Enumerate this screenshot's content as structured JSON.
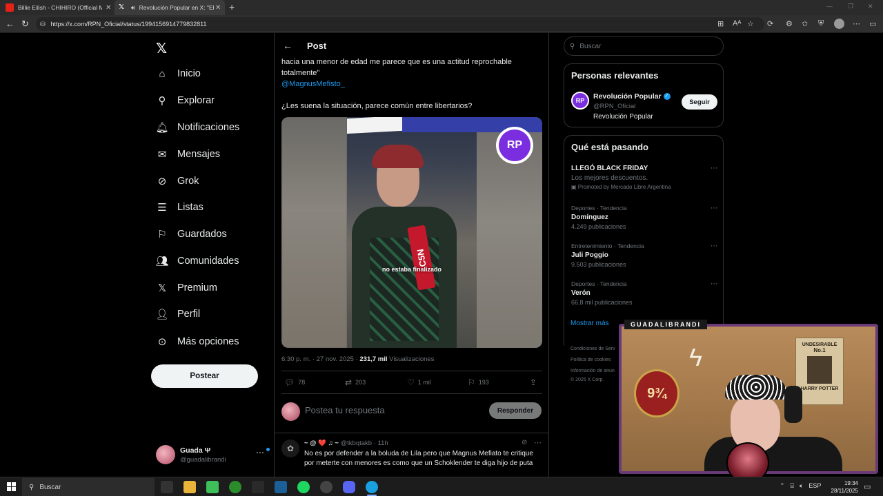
{
  "browser": {
    "tabs": [
      {
        "title": "Billie Eilish - CHIHIRO (Official Mu",
        "active": false
      },
      {
        "title": "Revolución Popular en X: \"El",
        "active": true
      }
    ],
    "new_tab": "+",
    "url": "https://x.com/RPN_Oficial/status/1994156914779832811"
  },
  "nav": {
    "items": [
      {
        "label": "Inicio",
        "icon": "home-icon"
      },
      {
        "label": "Explorar",
        "icon": "search-icon"
      },
      {
        "label": "Notificaciones",
        "icon": "bell-icon"
      },
      {
        "label": "Mensajes",
        "icon": "envelope-icon"
      },
      {
        "label": "Grok",
        "icon": "grok-icon"
      },
      {
        "label": "Listas",
        "icon": "list-icon"
      },
      {
        "label": "Guardados",
        "icon": "bookmark-icon"
      },
      {
        "label": "Comunidades",
        "icon": "people-icon"
      },
      {
        "label": "Premium",
        "icon": "x-icon"
      },
      {
        "label": "Perfil",
        "icon": "person-icon"
      },
      {
        "label": "Más opciones",
        "icon": "more-circle-icon"
      }
    ],
    "post_button": "Postear",
    "user": {
      "name": "Guada Ψ",
      "handle": "@guadalibrandi"
    }
  },
  "post": {
    "header": "Post",
    "text_line1": "hacia una menor de edad me parece que es una actitud reprochable",
    "text_line2": "totalmente\"",
    "mention": "@MagnusMefisto_",
    "text_line3": "¿Les suena la situación, parece común entre libertarios?",
    "media": {
      "badge": "RP",
      "mic_label": "C5N",
      "subtitle": "no estaba finalizado"
    },
    "meta_time": "6:30 p. m. · 27 nov. 2025 · ",
    "meta_views": "231,7 mil",
    "meta_views_label": " Visualizaciones",
    "stats": {
      "replies": "78",
      "reposts": "203",
      "likes": "1 mil",
      "bookmarks": "193"
    },
    "reply_placeholder": "Postea tu respuesta",
    "reply_button": "Responder"
  },
  "reply": {
    "name": "~ @ ❤️ ♫ ~",
    "handle": "@tkbqtakb",
    "time": "· 11h",
    "line1": "No es por defender a la boluda de Lila pero que Magnus Mefiato te critique",
    "line2": "por meterte con menores es como que un Schoklender te diga hijo de puta"
  },
  "sidebar": {
    "search_placeholder": "Buscar",
    "people_title": "Personas relevantes",
    "person": {
      "avatar": "RP",
      "name": "Revolución Popular",
      "handle": "@RPN_Oficial",
      "bio": "Revolución Popular",
      "follow": "Seguir"
    },
    "trends_title": "Qué está pasando",
    "trends": [
      {
        "category": "",
        "title": "LLEGÓ BLACK FRIDAY",
        "sub": "Los mejores descuentos.",
        "promo": "Promoted by Mercado Libre Argentina"
      },
      {
        "category": "Deportes · Tendencia",
        "title": "Domínguez",
        "sub": "4.249 publicaciones"
      },
      {
        "category": "Entretenimiento · Tendencia",
        "title": "Juli Poggio",
        "sub": "9.503 publicaciones"
      },
      {
        "category": "Deportes · Tendencia",
        "title": "Verón",
        "sub": "66,8 mil publicaciones"
      }
    ],
    "show_more": "Mostrar más",
    "footer": [
      "Condiciones de Serv",
      "Política de cookies",
      "Información de anun",
      "© 2025 X Corp."
    ]
  },
  "webcam": {
    "streamer_name": "GUADALIBRANDI",
    "platform_sign": "9¾",
    "poster_title": "UNDESIRABLE",
    "poster_no": "No.1",
    "poster_sub": "HARRY POTTER"
  },
  "taskbar": {
    "search": "Buscar",
    "language": "ESP",
    "time": "19:34",
    "date": "28/11/2025"
  }
}
